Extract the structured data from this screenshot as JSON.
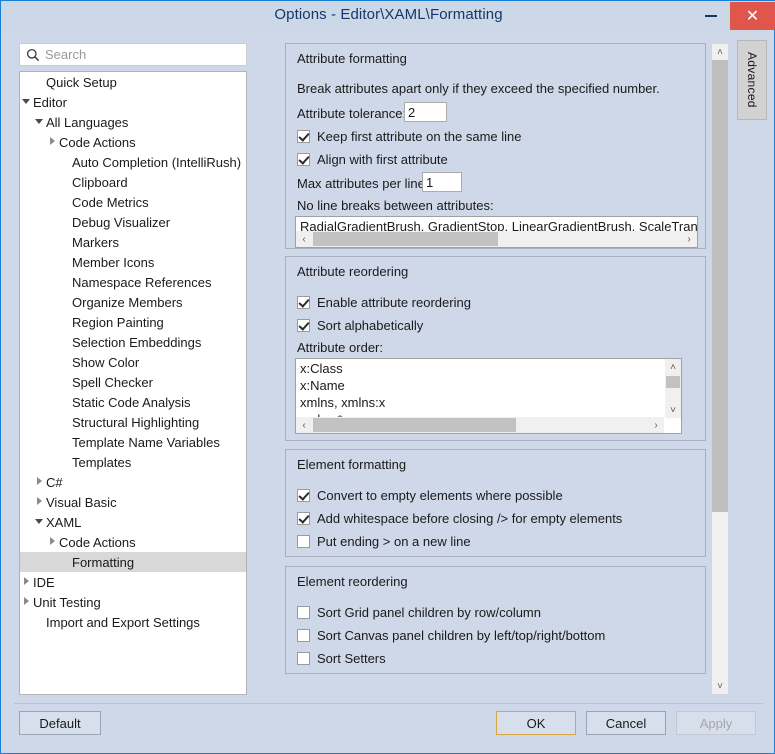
{
  "window": {
    "title": "Options - Editor\\XAML\\Formatting",
    "minimize_label": "–",
    "close_label": "✕"
  },
  "search": {
    "placeholder": "Search",
    "value": "",
    "icon": "search-icon"
  },
  "tree": {
    "items": [
      {
        "label": "Quick Setup",
        "indent": 1,
        "twisty": "none",
        "selected": false
      },
      {
        "label": "Editor",
        "indent": 0,
        "twisty": "expanded",
        "selected": false
      },
      {
        "label": "All Languages",
        "indent": 1,
        "twisty": "expanded",
        "selected": false
      },
      {
        "label": "Code Actions",
        "indent": 2,
        "twisty": "collapsed",
        "selected": false
      },
      {
        "label": "Auto Completion (IntelliRush)",
        "indent": 3,
        "twisty": "none",
        "selected": false
      },
      {
        "label": "Clipboard",
        "indent": 3,
        "twisty": "none",
        "selected": false
      },
      {
        "label": "Code Metrics",
        "indent": 3,
        "twisty": "none",
        "selected": false
      },
      {
        "label": "Debug Visualizer",
        "indent": 3,
        "twisty": "none",
        "selected": false
      },
      {
        "label": "Markers",
        "indent": 3,
        "twisty": "none",
        "selected": false
      },
      {
        "label": "Member Icons",
        "indent": 3,
        "twisty": "none",
        "selected": false
      },
      {
        "label": "Namespace References",
        "indent": 3,
        "twisty": "none",
        "selected": false
      },
      {
        "label": "Organize Members",
        "indent": 3,
        "twisty": "none",
        "selected": false
      },
      {
        "label": "Region Painting",
        "indent": 3,
        "twisty": "none",
        "selected": false
      },
      {
        "label": "Selection Embeddings",
        "indent": 3,
        "twisty": "none",
        "selected": false
      },
      {
        "label": "Show Color",
        "indent": 3,
        "twisty": "none",
        "selected": false
      },
      {
        "label": "Spell Checker",
        "indent": 3,
        "twisty": "none",
        "selected": false
      },
      {
        "label": "Static Code Analysis",
        "indent": 3,
        "twisty": "none",
        "selected": false
      },
      {
        "label": "Structural Highlighting",
        "indent": 3,
        "twisty": "none",
        "selected": false
      },
      {
        "label": "Template Name Variables",
        "indent": 3,
        "twisty": "none",
        "selected": false
      },
      {
        "label": "Templates",
        "indent": 3,
        "twisty": "none",
        "selected": false
      },
      {
        "label": "C#",
        "indent": 1,
        "twisty": "collapsed",
        "selected": false
      },
      {
        "label": "Visual Basic",
        "indent": 1,
        "twisty": "collapsed",
        "selected": false
      },
      {
        "label": "XAML",
        "indent": 1,
        "twisty": "expanded",
        "selected": false
      },
      {
        "label": "Code Actions",
        "indent": 2,
        "twisty": "collapsed",
        "selected": false
      },
      {
        "label": "Formatting",
        "indent": 3,
        "twisty": "none",
        "selected": true
      },
      {
        "label": "IDE",
        "indent": 0,
        "twisty": "collapsed",
        "selected": false
      },
      {
        "label": "Unit Testing",
        "indent": 0,
        "twisty": "collapsed",
        "selected": false
      },
      {
        "label": "Import and Export Settings",
        "indent": 1,
        "twisty": "none",
        "selected": false
      }
    ]
  },
  "advanced_tab": {
    "label": "Advanced"
  },
  "groups": {
    "attribute_formatting": {
      "title": "Attribute formatting",
      "description": "Break attributes apart only if they exceed the specified number.",
      "attribute_tolerance_label": "Attribute tolerance:",
      "attribute_tolerance_value": "2",
      "keep_first_attribute_label": "Keep first attribute on the same line",
      "align_with_first_label": "Align with first attribute",
      "max_attributes_label": "Max attributes per line:",
      "max_attributes_value": "1",
      "no_line_breaks_label": "No line breaks between attributes:",
      "no_line_breaks_value": "RadialGradientBrush, GradientStop, LinearGradientBrush, ScaleTransfom,"
    },
    "attribute_reordering": {
      "title": "Attribute reordering",
      "enable_label": "Enable attribute reordering",
      "sort_alpha_label": "Sort alphabetically",
      "attribute_order_label": "Attribute order:",
      "attribute_order_items": [
        "x:Class",
        "x:Name",
        "xmlns, xmlns:x",
        "xmlns:*"
      ]
    },
    "element_formatting": {
      "title": "Element formatting",
      "convert_empty_label": "Convert to empty elements where possible",
      "add_whitespace_label": "Add whitespace before closing /> for empty elements",
      "put_ending_label": "Put ending > on a new line"
    },
    "element_reordering": {
      "title": "Element reordering",
      "sort_grid_label": "Sort Grid panel children by row/column",
      "sort_canvas_label": "Sort Canvas panel children by left/top/right/bottom",
      "sort_setters_label": "Sort Setters"
    }
  },
  "checkbox_states": {
    "keep_first_attribute": true,
    "align_with_first": true,
    "enable_reordering": true,
    "sort_alphabetically": true,
    "convert_empty": true,
    "add_whitespace": true,
    "put_ending": false,
    "sort_grid": false,
    "sort_canvas": false,
    "sort_setters": false
  },
  "footer": {
    "default_label": "Default",
    "ok_label": "OK",
    "cancel_label": "Cancel",
    "apply_label": "Apply"
  },
  "scroll_arrows": {
    "up": "˄",
    "down": "˅",
    "left": "‹",
    "right": "›"
  },
  "colors": {
    "window_background": "#cfd8e8",
    "title_bar": "#ccd7e8",
    "title_text": "#15386b",
    "close_button": "#e1564c",
    "window_border": "#1a7fd4",
    "selection": "#d8d8d8",
    "ok_focus_border": "#d8a740",
    "scrollbar_thumb": "#bfbfbf"
  }
}
